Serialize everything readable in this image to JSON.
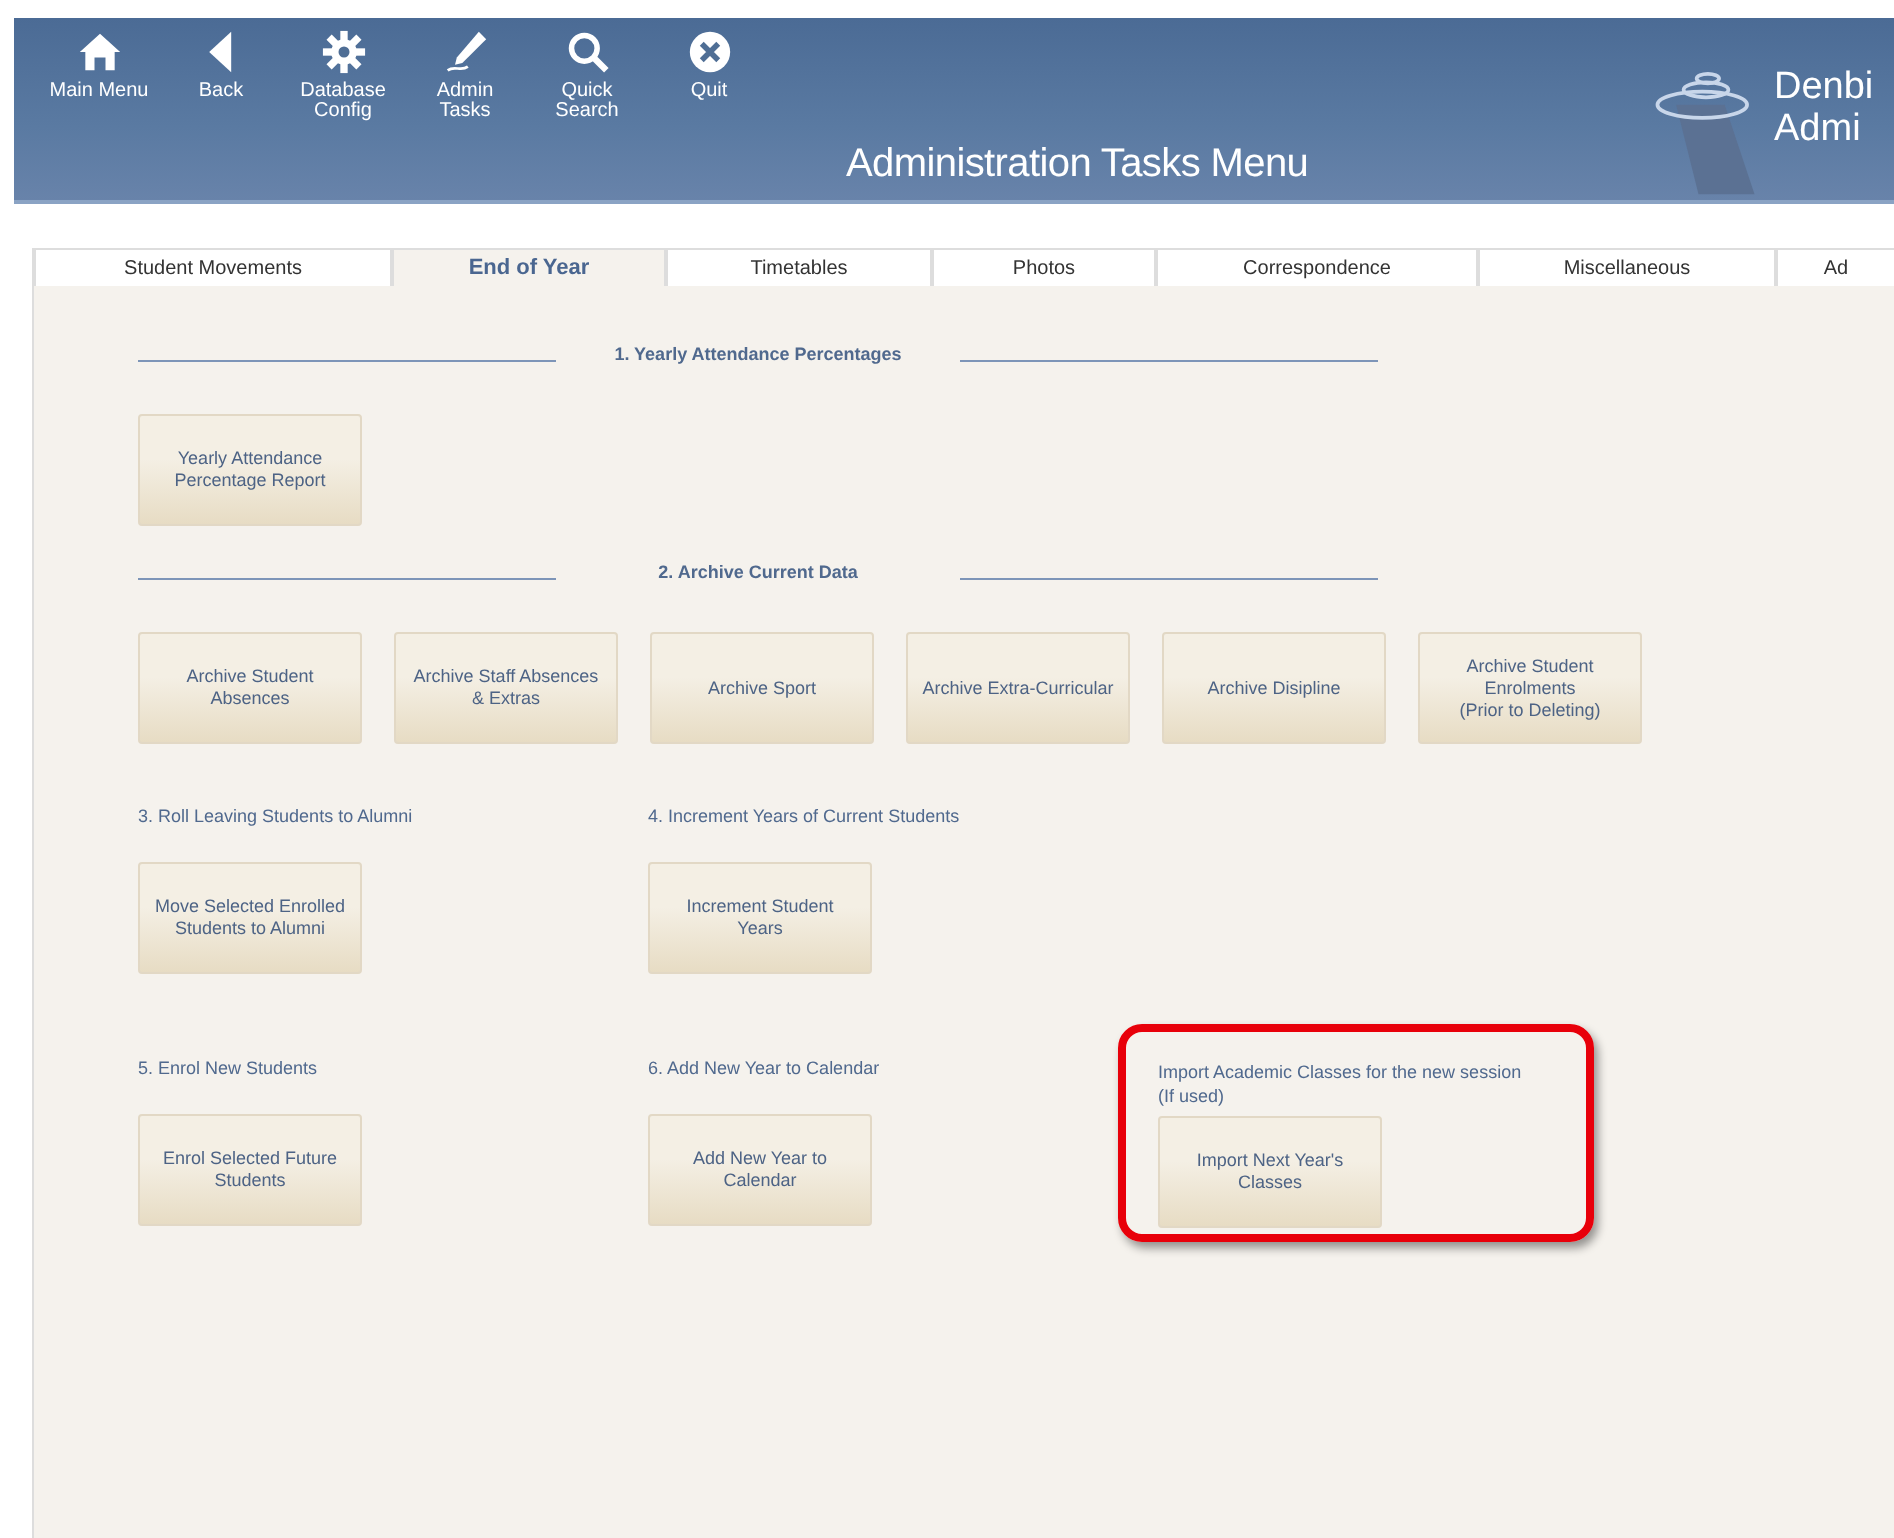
{
  "toolbar": [
    {
      "label": "Main Menu"
    },
    {
      "label": "Back"
    },
    {
      "label": "Database\nConfig"
    },
    {
      "label": "Admin\nTasks"
    },
    {
      "label": "Quick\nSearch"
    },
    {
      "label": "Quit"
    }
  ],
  "window": {
    "title": "Administration Tasks Menu"
  },
  "logo": {
    "lines": [
      "Denbi",
      "Admi"
    ]
  },
  "tabs": [
    {
      "label": "Student Movements",
      "selected": false
    },
    {
      "label": "End of Year",
      "selected": true
    },
    {
      "label": "Timetables",
      "selected": false
    },
    {
      "label": "Photos",
      "selected": false
    },
    {
      "label": "Correspondence",
      "selected": false
    },
    {
      "label": "Miscellaneous",
      "selected": false
    },
    {
      "label": "Ad",
      "selected": false
    }
  ],
  "sections": [
    {
      "kind": "heading",
      "title": "1. Yearly Attendance Percentages",
      "buttons": [
        "Yearly Attendance\nPercentage Report"
      ]
    },
    {
      "kind": "heading",
      "title": "2. Archive Current Data",
      "buttons": [
        "Archive Student\nAbsences",
        "Archive Staff Absences\n& Extras",
        "Archive Sport",
        "Archive Extra-Curricular",
        "Archive Disipline",
        "Archive Student\nEnrolments\n(Prior to Deleting)"
      ]
    },
    {
      "kind": "groups",
      "groups": [
        {
          "label": "3. Roll Leaving Students to Alumni",
          "button": "Move Selected Enrolled\nStudents to Alumni",
          "highlighted": false
        },
        {
          "label": "4. Increment Years of Current Students",
          "button": "Increment Student\nYears",
          "highlighted": false
        }
      ]
    },
    {
      "kind": "groups",
      "groups": [
        {
          "label": "5. Enrol New Students",
          "button": "Enrol Selected Future\nStudents",
          "highlighted": false
        },
        {
          "label": "6. Add New Year to Calendar",
          "button": "Add New Year to\nCalendar",
          "highlighted": false
        },
        {
          "label": "Import Academic Classes for the new session\n(If used)",
          "button": "Import Next Year's\nClasses",
          "highlighted": true
        }
      ]
    }
  ]
}
